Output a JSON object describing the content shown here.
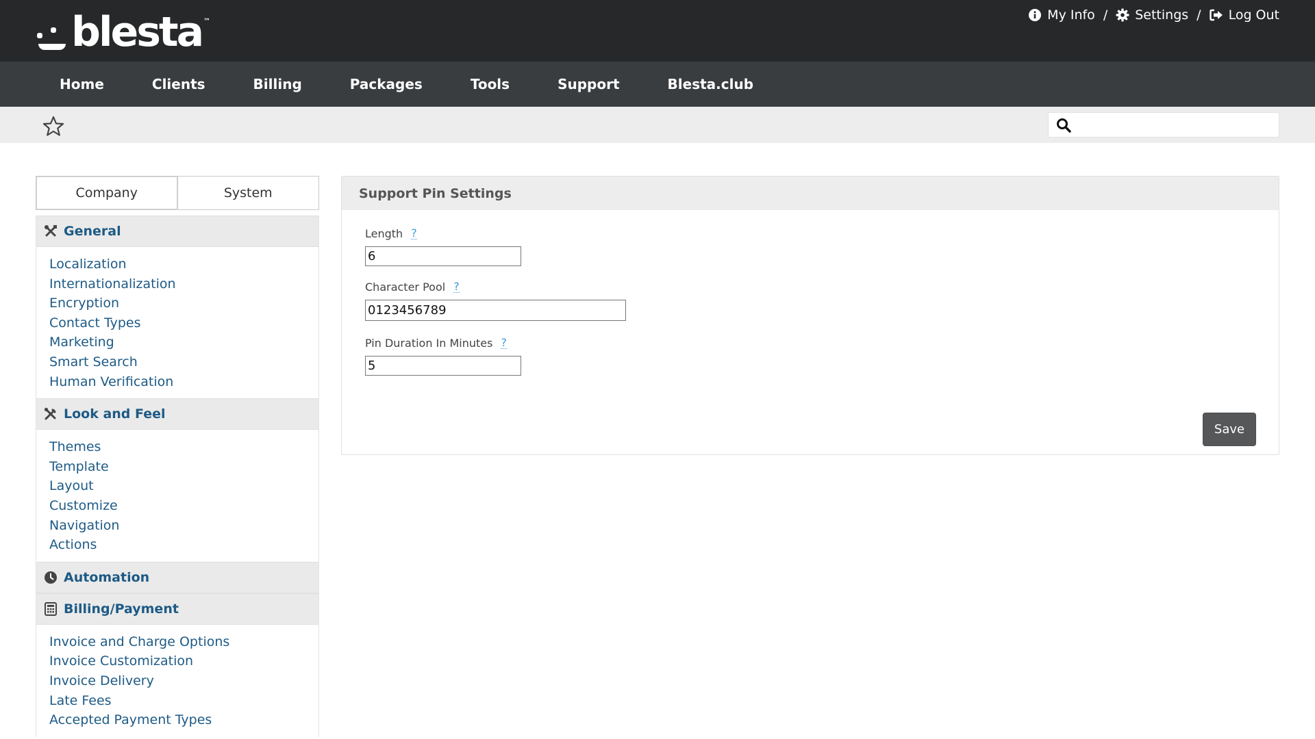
{
  "header": {
    "logo_text": "blesta",
    "logo_tm": "™",
    "user_links": [
      {
        "label": "My Info",
        "icon": "info-circle-icon"
      },
      {
        "label": "Settings",
        "icon": "gear-icon"
      },
      {
        "label": "Log Out",
        "icon": "sign-out-icon"
      }
    ],
    "separator": "/"
  },
  "nav": {
    "items": [
      "Home",
      "Clients",
      "Billing",
      "Packages",
      "Tools",
      "Support",
      "Blesta.club"
    ]
  },
  "subbar": {
    "star_icon": "star-outline-icon",
    "search": {
      "icon": "search-icon",
      "value": "",
      "placeholder": ""
    }
  },
  "sidebar": {
    "tabs": [
      "Company",
      "System"
    ],
    "sections": [
      {
        "title": "General",
        "icon": "tools-icon",
        "items": [
          "Localization",
          "Internationalization",
          "Encryption",
          "Contact Types",
          "Marketing",
          "Smart Search",
          "Human Verification"
        ]
      },
      {
        "title": "Look and Feel",
        "icon": "brush-icon",
        "items": [
          "Themes",
          "Template",
          "Layout",
          "Customize",
          "Navigation",
          "Actions"
        ]
      },
      {
        "title": "Automation",
        "icon": "clock-icon",
        "items": []
      },
      {
        "title": "Billing/Payment",
        "icon": "calculator-icon",
        "items": [
          "Invoice and Charge Options",
          "Invoice Customization",
          "Invoice Delivery",
          "Late Fees",
          "Accepted Payment Types"
        ]
      }
    ]
  },
  "panel": {
    "title": "Support Pin Settings",
    "fields": {
      "length": {
        "label": "Length",
        "help": "?",
        "value": "6"
      },
      "character_pool": {
        "label": "Character Pool",
        "help": "?",
        "value": "0123456789"
      },
      "pin_duration": {
        "label": "Pin Duration In Minutes",
        "help": "?",
        "value": "5"
      }
    },
    "save_label": "Save"
  },
  "colors": {
    "topbar": "#26282a",
    "nav": "#3a3d40",
    "link": "#1d5a85",
    "help": "#3a9ad9",
    "button": "#555759"
  }
}
